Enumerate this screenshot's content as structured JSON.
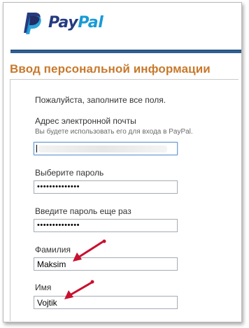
{
  "brand": {
    "pay": "Pay",
    "pal": "Pal",
    "colors": {
      "pay": "#253b80",
      "pal": "#179bd7"
    }
  },
  "page": {
    "title": "Ввод персональной информации",
    "intro": "Пожалуйста, заполните все поля."
  },
  "form": {
    "email": {
      "label": "Адрес электронной почты",
      "hint": "Вы будете использовать его для входа в PayPal.",
      "value": ""
    },
    "password": {
      "label": "Выберите пароль",
      "value": "••••••••••••••"
    },
    "password_confirm": {
      "label": "Введите пароль еще раз",
      "value": "••••••••••••••"
    },
    "last_name": {
      "label": "Фамилия",
      "value": "Maksim"
    },
    "first_name": {
      "label": "Имя",
      "value": "Vojtik"
    }
  },
  "colors": {
    "accent_title": "#c8792d",
    "bar": "#2f5f93",
    "arrow": "#c8102e"
  },
  "icons": {
    "logo": "paypal-logo-icon",
    "annotation": "red-arrow-icon"
  }
}
